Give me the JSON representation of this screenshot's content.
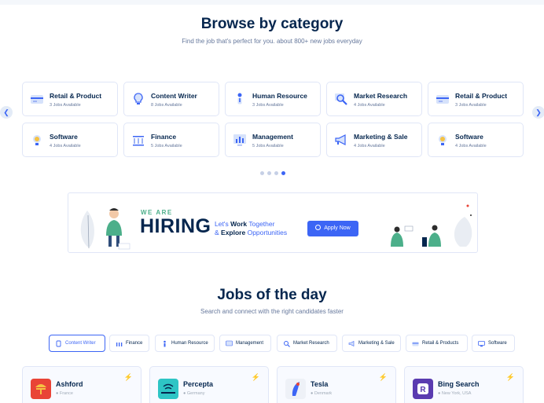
{
  "browse": {
    "title": "Browse by category",
    "subtitle": "Find the job that's perfect for you. about 800+ new jobs everyday",
    "prev_icon": "chevron-left-icon",
    "next_icon": "chevron-right-icon",
    "categories": [
      {
        "title": "Retail & Product",
        "count": "3 Jobs Available",
        "icon": "retail-icon"
      },
      {
        "title": "Content Writer",
        "count": "8 Jobs Available",
        "icon": "lightbulb-icon"
      },
      {
        "title": "Human Resource",
        "count": "3 Jobs Available",
        "icon": "person-icon"
      },
      {
        "title": "Market Research",
        "count": "4 Jobs Available",
        "icon": "magnifier-icon"
      },
      {
        "title": "Retail & Product",
        "count": "3 Jobs Available",
        "icon": "retail-icon"
      },
      {
        "title": "Software",
        "count": "4 Jobs Available",
        "icon": "idea-icon"
      },
      {
        "title": "Finance",
        "count": "5 Jobs Available",
        "icon": "finance-icon"
      },
      {
        "title": "Management",
        "count": "5 Jobs Available",
        "icon": "chart-icon"
      },
      {
        "title": "Marketing & Sale",
        "count": "4 Jobs Available",
        "icon": "megaphone-icon"
      },
      {
        "title": "Software",
        "count": "4 Jobs Available",
        "icon": "idea-icon"
      }
    ],
    "pagination": {
      "total": 4,
      "active": 4
    }
  },
  "banner": {
    "we_are": "WE ARE",
    "hiring": "HIRING",
    "line1_pre": "Let's ",
    "line1_bold": "Work",
    "line1_post": " Together",
    "line2_pre": "& ",
    "line2_bold": "Explore",
    "line2_post": " Opportunities",
    "apply_label": "Apply Now"
  },
  "jobs": {
    "title": "Jobs of the day",
    "subtitle": "Search and connect with the right candidates faster",
    "filters": [
      {
        "label": "Content Writer",
        "active": true
      },
      {
        "label": "Finance",
        "active": false
      },
      {
        "label": "Human Resource",
        "active": false
      },
      {
        "label": "Management",
        "active": false
      },
      {
        "label": "Market Research",
        "active": false
      },
      {
        "label": "Marketing & Sale",
        "active": false
      },
      {
        "label": "Retail & Products",
        "active": false
      },
      {
        "label": "Software",
        "active": false
      }
    ],
    "cards": [
      {
        "company": "Ashford",
        "location": "France",
        "logo_color": "#e94437"
      },
      {
        "company": "Percepta",
        "location": "Germany",
        "logo_color": "#2ec5c5"
      },
      {
        "company": "Tesla",
        "location": "Denmark",
        "logo_color": "#eef1f7"
      },
      {
        "company": "Bing Search",
        "location": "New York, USA",
        "logo_color": "#5a3bb0"
      }
    ]
  },
  "colors": {
    "primary": "#3c65f5",
    "heading": "#05264e",
    "muted": "#66789c",
    "accent_green": "#4caf8a"
  }
}
